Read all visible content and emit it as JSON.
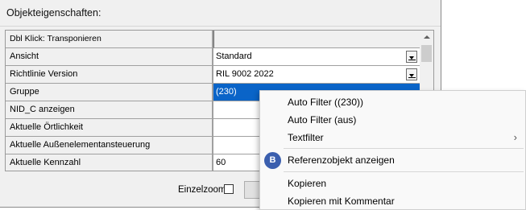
{
  "dialog": {
    "title": "Objekteigenschaften:",
    "grid": {
      "header_label": "Dbl Klick: Transponieren",
      "rows": [
        {
          "name": "Ansicht",
          "value": "Standard"
        },
        {
          "name": "Richtlinie Version",
          "value": "RIL 9002 2022"
        },
        {
          "name": "Gruppe",
          "value": "(230)"
        },
        {
          "name": "NID_C anzeigen",
          "value": ""
        },
        {
          "name": "Aktuelle Örtlichkeit",
          "value": ""
        },
        {
          "name": "Aktuelle Außenelementansteuerung",
          "value": ""
        },
        {
          "name": "Aktuelle Kennzahl",
          "value": "60"
        }
      ]
    },
    "einzelzoom_label": "Einzelzoom",
    "einzelzoom_checked": false
  },
  "context_menu": {
    "items": [
      {
        "label": "Auto Filter ((230))"
      },
      {
        "label": "Auto Filter (aus)"
      },
      {
        "label": "Textfilter",
        "submenu_arrow": "›"
      },
      {
        "label": "Referenzobjekt anzeigen",
        "icon_letter": "B"
      },
      {
        "label": "Kopieren"
      },
      {
        "label": "Kopieren mit Kommentar"
      }
    ]
  },
  "colors": {
    "selection": "#0a64c8",
    "menu_icon": "#3b5fae"
  }
}
